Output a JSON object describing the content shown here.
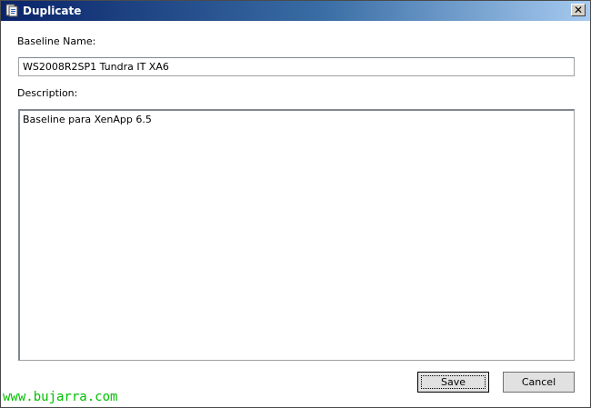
{
  "window": {
    "title": "Duplicate",
    "close_glyph": "✕"
  },
  "form": {
    "baseline_name_label": "Baseline Name:",
    "baseline_name_value": "WS2008R2SP1 Tundra IT XA6",
    "description_label": "Description:",
    "description_value": "Baseline para XenApp 6.5"
  },
  "buttons": {
    "save_label": "Save",
    "cancel_label": "Cancel"
  },
  "watermark": "www.bujarra.com",
  "icons": {
    "app": "document-duplicate-icon",
    "close": "close-icon"
  }
}
